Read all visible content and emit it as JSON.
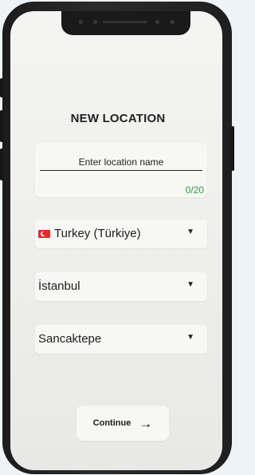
{
  "screen_title": "NEW LOCATION",
  "location_name": {
    "placeholder": "Enter location name",
    "value": "",
    "counter": "0/20"
  },
  "country_select": {
    "label": "Turkey (Türkiye)",
    "flag": "turkey-flag-icon"
  },
  "city_select": {
    "label": "İstanbul"
  },
  "district_select": {
    "label": "Sancaktepe"
  },
  "continue_button": {
    "label": "Continue",
    "icon": "arrow-right-icon"
  },
  "colors": {
    "counter_green": "#2e9a3c",
    "flag_red": "#e32a2a"
  }
}
